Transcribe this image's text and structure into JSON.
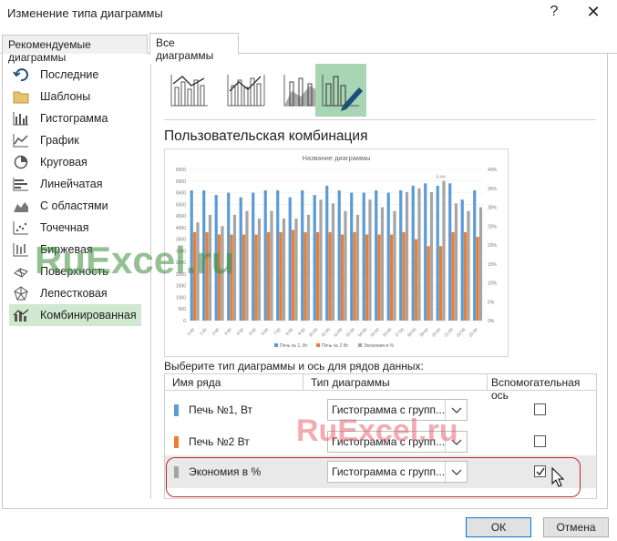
{
  "window": {
    "title": "Изменение типа диаграммы",
    "help": "?",
    "close": "✕"
  },
  "tabs": [
    {
      "label": "Рекомендуемые диаграммы",
      "active": false
    },
    {
      "label": "Все диаграммы",
      "active": true
    }
  ],
  "sidebar": {
    "items": [
      {
        "label": "Последние",
        "icon": "undo-icon"
      },
      {
        "label": "Шаблоны",
        "icon": "folder-icon"
      },
      {
        "label": "Гистограмма",
        "icon": "column-chart-icon"
      },
      {
        "label": "График",
        "icon": "line-chart-icon"
      },
      {
        "label": "Круговая",
        "icon": "pie-chart-icon"
      },
      {
        "label": "Линейчатая",
        "icon": "bar-chart-icon"
      },
      {
        "label": "С областями",
        "icon": "area-chart-icon"
      },
      {
        "label": "Точечная",
        "icon": "scatter-chart-icon"
      },
      {
        "label": "Биржевая",
        "icon": "stock-chart-icon"
      },
      {
        "label": "Поверхность",
        "icon": "surface-chart-icon"
      },
      {
        "label": "Лепестковая",
        "icon": "radar-chart-icon"
      },
      {
        "label": "Комбинированная",
        "icon": "combo-chart-icon",
        "active": true
      }
    ]
  },
  "combo": {
    "title": "Пользовательская комбинация",
    "preview_title": "Название диаграммы",
    "select_label": "Выберите тип диаграммы и ось для рядов данных:",
    "headers": {
      "name": "Имя ряда",
      "type": "Тип диаграммы",
      "secondary": "Вспомогательная ось"
    },
    "rows": [
      {
        "name": "Печь №1, Вт",
        "type": "Гистограмма с групп...",
        "secondary": false,
        "color": "#5b9bd5"
      },
      {
        "name": "Печь №2 Вт",
        "type": "Гистограмма с групп...",
        "secondary": false,
        "color": "#ed7d31"
      },
      {
        "name": "Экономия в %",
        "type": "Гистограмма с групп...",
        "secondary": true,
        "color": "#a5a5a5"
      }
    ]
  },
  "buttons": {
    "ok": "ОК",
    "cancel": "Отмена"
  },
  "watermark": {
    "text1": "RuExcel.ru",
    "text2": "RuExcel.ru"
  },
  "chart_data": {
    "type": "bar",
    "title": "Название диаграммы",
    "categories": [
      "0:00",
      "1:00",
      "2:00",
      "3:00",
      "4:00",
      "5:00",
      "6:00",
      "7:00",
      "8:00",
      "9:00",
      "10:00",
      "11:00",
      "12:00",
      "13:00",
      "14:00",
      "15:00",
      "16:00",
      "17:00",
      "18:00",
      "19:00",
      "20:00",
      "21:00",
      "22:00",
      "23:00"
    ],
    "primary_ticks": [
      "0",
      "500",
      "1000",
      "1500",
      "2000",
      "2500",
      "3000",
      "3500",
      "4000",
      "4500",
      "5000",
      "5500",
      "6000",
      "6500"
    ],
    "secondary_ticks": [
      "0%",
      "5%",
      "10%",
      "15%",
      "20%",
      "25%",
      "30%",
      "35%",
      "40%"
    ],
    "ylim": [
      0,
      6500
    ],
    "y2lim": [
      0,
      0.4
    ],
    "annotation": "0.4%",
    "series": [
      {
        "name": "Печь № 1, Вт",
        "color": "#5b9bd5",
        "axis": "primary",
        "values": [
          5600,
          5600,
          5400,
          5500,
          5300,
          5500,
          5600,
          5600,
          5300,
          5600,
          5400,
          5800,
          5600,
          5500,
          5500,
          5600,
          5500,
          5600,
          5800,
          5900,
          5800,
          5900,
          5200,
          5600
        ]
      },
      {
        "name": "Печь № 2 Вт",
        "color": "#ed7d31",
        "axis": "primary",
        "values": [
          3800,
          3800,
          3700,
          3700,
          3700,
          3700,
          3800,
          3800,
          3900,
          3800,
          3800,
          3800,
          3700,
          3800,
          3700,
          3700,
          3700,
          3800,
          3500,
          3200,
          3200,
          3800,
          3800,
          3600
        ]
      },
      {
        "name": "Экономия в %",
        "color": "#a5a5a5",
        "axis": "secondary",
        "values": [
          0.26,
          0.28,
          0.25,
          0.28,
          0.29,
          0.27,
          0.29,
          0.27,
          0.27,
          0.28,
          0.32,
          0.31,
          0.29,
          0.28,
          0.32,
          0.3,
          0.29,
          0.34,
          0.35,
          0.34,
          0.37,
          0.31,
          0.29,
          0.3
        ]
      }
    ]
  }
}
